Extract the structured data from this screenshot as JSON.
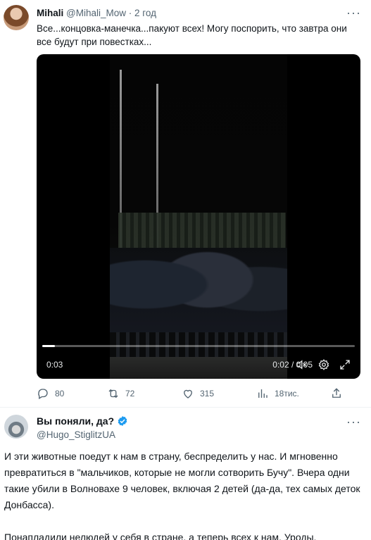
{
  "tweet1": {
    "author_name": "Mihali",
    "author_handle": "@Mihali_Mow",
    "separator": "·",
    "time_ago": "2 год",
    "more_label": "···",
    "text": "Все...концовка-манечка...пакуют всех! Могу поспорить, что завтра они все будут при повестках...",
    "video": {
      "current_time": "0:03",
      "time_display": "0:02 / 0:05",
      "progress_fraction": 0.04
    },
    "actions": {
      "replies": "80",
      "retweets": "72",
      "likes": "315",
      "views": "18тис."
    }
  },
  "tweet2": {
    "author_name": "Вы поняли, да?",
    "author_handle": "@Hugo_StiglitzUA",
    "verified_color": "#1d9bf0",
    "more_label": "···",
    "paragraphs": [
      "И эти животные поедут к нам в страну, беспределить у нас. И мгновенно превратиться в \"мальчиков, которые не могли сотворить Бучу\". Вчера одни такие убили в Волновахе 9 человек, включая 2 детей (да-да, тех самых деток Донбасса).",
      "Понапладили нелюдей у себя в стране, а теперь всех к нам. Уроды."
    ]
  },
  "colors": {
    "text": "#0f1419",
    "muted": "#536471",
    "divider": "#eff3f4"
  }
}
